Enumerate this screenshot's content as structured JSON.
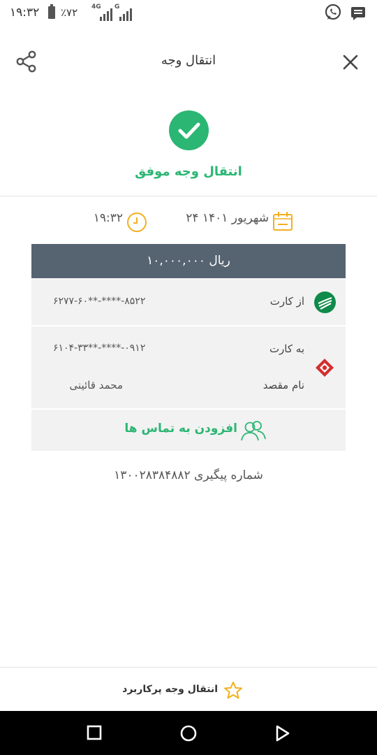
{
  "status_bar": {
    "time": "۱۹:۳۲",
    "battery": "٪۷۲",
    "network_4g": "4G",
    "network_g": "G"
  },
  "header": {
    "title": "انتقال وجه"
  },
  "result": {
    "message": "انتقال وجه موفق"
  },
  "datetime": {
    "date": "۲۴ شهریور ۱۴۰۱",
    "time": "۱۹:۳۲"
  },
  "transfer": {
    "amount": "۱۰,۰۰۰,۰۰۰ ریال",
    "from_label": "از کارت",
    "from_card": "۶۲۷۷-۶۰**-****-۸۵۲۲",
    "to_label": "به کارت",
    "to_card": "۶۱۰۴-۳۳**-****-۰۹۱۲",
    "dest_name_label": "نام مقصد",
    "dest_name": "محمد   قائینی"
  },
  "add_contact_label": "افزودن به تماس ها",
  "tracking": "شماره پیگیری ۱۳۰۰۲۸۳۸۴۸۸۲",
  "favorite_label": "انتقال وجه پرکاربرد",
  "colors": {
    "accent_green": "#2bb673",
    "amount_bar": "#566371",
    "clock_yellow": "#f2b01e",
    "panel_bg": "#f2f2f2"
  },
  "icons": [
    "whatsapp-icon",
    "message-icon",
    "share-icon",
    "close-icon",
    "check-icon",
    "calendar-icon",
    "clock-icon",
    "bank-green-icon",
    "bank-red-icon",
    "contacts-icon",
    "star-icon",
    "square-nav-icon",
    "circle-nav-icon",
    "triangle-nav-icon"
  ]
}
